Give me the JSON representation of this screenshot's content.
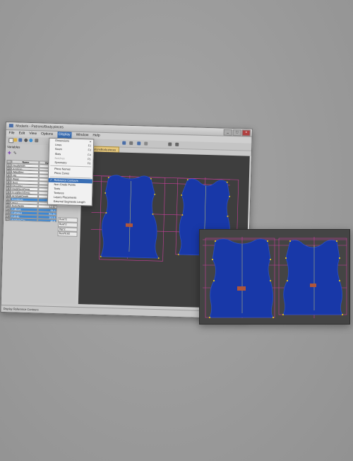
{
  "window": {
    "title": "Modaris - Patrons/Body.pieces",
    "controls": [
      "_",
      "□",
      "×"
    ]
  },
  "menubar": [
    "File",
    "Edit",
    "View",
    "Options",
    "Display",
    "Window",
    "Help"
  ],
  "active_menu": "Display",
  "file_tab": "PatronsBody.pieces",
  "sidebar": {
    "label": "Variables",
    "table_headers": [
      "Name",
      "Value"
    ],
    "rows": [
      {
        "n": "1",
        "name": "NeckWidth",
        "value": "15.3"
      },
      {
        "n": "2",
        "name": "Armhole",
        "value": "20.3"
      },
      {
        "n": "3",
        "name": "WaistDeg",
        "value": "22.59"
      },
      {
        "n": "4",
        "name": "Hip",
        "value": "50.74"
      },
      {
        "n": "5",
        "name": "Waist",
        "value": "42.1"
      },
      {
        "n": "6",
        "name": "Bust",
        "value": "46.4"
      },
      {
        "n": "7",
        "name": "Shoulder",
        "value": "10.95"
      },
      {
        "n": "8",
        "name": "BackNeckDeep",
        "value": "2.62"
      },
      {
        "n": "9",
        "name": "FrontNeckDeep",
        "value": "6.55"
      },
      {
        "n": "10",
        "name": "ArmholeDepth",
        "value": "22.4"
      },
      {
        "n": "11",
        "name": "FrontBust",
        "value": "12.3"
      },
      {
        "n": "12",
        "name": "Wrist",
        "value": "13.25"
      },
      {
        "n": "13",
        "name": "BodyWidth",
        "value": "12.67"
      },
      {
        "n": "14",
        "name": "FullBust",
        "value": "94.4"
      },
      {
        "n": "15",
        "name": "FullWaist",
        "value": "84.20"
      },
      {
        "n": "16",
        "name": "FullHip",
        "value": "101.5"
      },
      {
        "n": "17",
        "name": "ArmholeCirc",
        "value": "40.6"
      }
    ],
    "extra_values": [
      "Bust*2",
      "Bust*2",
      "Hip*2",
      "Bust*0.82"
    ]
  },
  "dropdown": {
    "items": [
      {
        "label": "Dimensions",
        "shortcut": "▸",
        "state": "normal"
      },
      {
        "label": "Lines",
        "shortcut": "F2",
        "state": "normal"
      },
      {
        "label": "Seam",
        "shortcut": "F3",
        "state": "normal"
      },
      {
        "label": "Slots",
        "shortcut": "F4",
        "state": "normal"
      },
      {
        "label": "Notches",
        "shortcut": "F5",
        "state": "disabled"
      },
      {
        "label": "Symmetry",
        "shortcut": "F6",
        "state": "normal"
      },
      {
        "sep": true
      },
      {
        "label": "Piece Names",
        "shortcut": "",
        "state": "normal"
      },
      {
        "label": "Piece Zones",
        "shortcut": "",
        "state": "normal"
      },
      {
        "sep": true
      },
      {
        "label": "Reference Contours",
        "shortcut": "",
        "state": "highlight",
        "checked": true
      },
      {
        "label": "Non-Grade Points",
        "shortcut": "",
        "state": "normal"
      },
      {
        "label": "Texts",
        "shortcut": "",
        "state": "normal"
      },
      {
        "label": "Textures",
        "shortcut": "",
        "state": "normal"
      },
      {
        "label": "Layers Placements",
        "shortcut": "",
        "state": "normal"
      },
      {
        "label": "External Segments Length",
        "shortcut": "",
        "state": "normal"
      }
    ]
  },
  "statusbar": "Display Reference Contours",
  "colors": {
    "canvas": "#3e3e3e",
    "piece_fill": "#1838a8",
    "piece_stroke": "#2a4fc6",
    "guide": "#c8409a",
    "point": "#e2c020",
    "grain": "#cfd070",
    "marker": "#b0553a",
    "highlight": "#3a6fb5"
  },
  "icons": [
    "app-icon",
    "new-icon",
    "open-icon",
    "save-icon",
    "undo-icon",
    "redo-icon",
    "zoom-icon",
    "pan-icon",
    "add-icon",
    "settings-icon"
  ]
}
